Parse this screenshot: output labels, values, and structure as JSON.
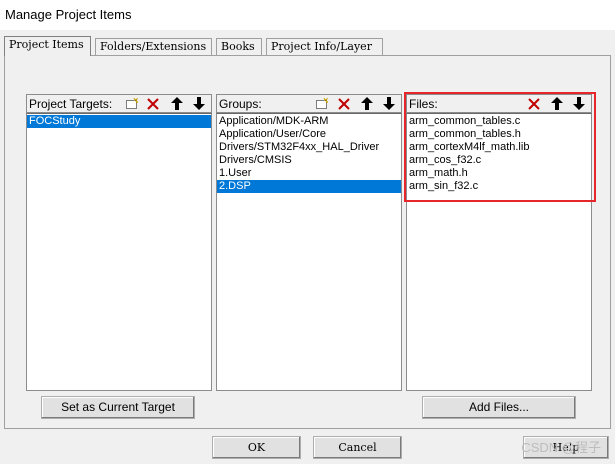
{
  "window": {
    "title": "Manage Project Items"
  },
  "tabs": [
    {
      "label": "Project Items",
      "active": true
    },
    {
      "label": "Folders/Extensions",
      "active": false
    },
    {
      "label": "Books",
      "active": false
    },
    {
      "label": "Project Info/Layer",
      "active": false
    }
  ],
  "targets": {
    "label": "Project Targets:",
    "items": [
      "FOCStudy"
    ],
    "selected_index": 0
  },
  "groups": {
    "label": "Groups:",
    "items": [
      "Application/MDK-ARM",
      "Application/User/Core",
      "Drivers/STM32F4xx_HAL_Driver",
      "Drivers/CMSIS",
      "1.User",
      "2.DSP"
    ],
    "selected_index": 5
  },
  "files": {
    "label": "Files:",
    "items": [
      "arm_common_tables.c",
      "arm_common_tables.h",
      "arm_cortexM4lf_math.lib",
      "arm_cos_f32.c",
      "arm_math.h",
      "arm_sin_f32.c"
    ]
  },
  "buttons": {
    "set_current": "Set as Current Target",
    "add_files": "Add Files...",
    "ok": "OK",
    "cancel": "Cancel",
    "help": "Help"
  },
  "icons": [
    "new-item-icon",
    "delete-icon",
    "move-up-icon",
    "move-down-icon"
  ],
  "colors": {
    "selection": "#0078d7",
    "highlight_box": "#e6262b",
    "delete": "#c00000"
  },
  "watermark": "CSDN @程子"
}
